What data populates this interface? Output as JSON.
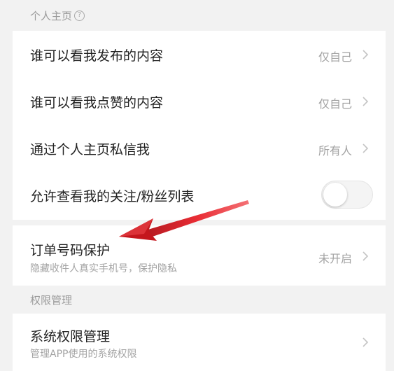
{
  "sections": {
    "personal_home": {
      "title": "个人主页",
      "help_glyph": "?"
    },
    "permissions": {
      "title": "权限管理"
    }
  },
  "rows": {
    "who_can_see_posts": {
      "title": "谁可以看我发布的内容",
      "value": "仅自己"
    },
    "who_can_see_likes": {
      "title": "谁可以看我点赞的内容",
      "value": "仅自己"
    },
    "dm_via_home": {
      "title": "通过个人主页私信我",
      "value": "所有人"
    },
    "follow_fan_list": {
      "title": "允许查看我的关注/粉丝列表",
      "toggle_on": false
    },
    "order_number_protection": {
      "title": "订单号码保护",
      "subtitle": "隐藏收件人真实手机号，保护隐私",
      "value": "未开启"
    },
    "system_permissions": {
      "title": "系统权限管理",
      "subtitle": "管理APP使用的系统权限"
    }
  },
  "colors": {
    "page_bg": "#f2f2f2",
    "card_bg": "#ffffff",
    "title_text": "#222222",
    "muted_text": "#a3a3a3",
    "arrow_red": "#d4141c"
  },
  "icons": {
    "chevron": "chevron-right-icon",
    "help": "help-circle-icon",
    "annotation": "red-arrow-annotation"
  }
}
